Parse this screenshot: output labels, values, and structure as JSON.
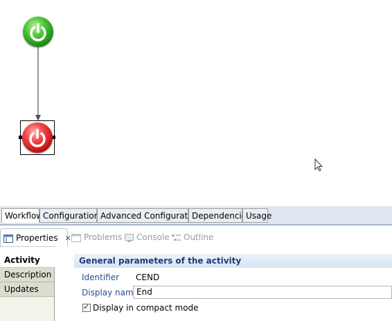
{
  "editor_tabs": [
    "Workflow",
    "Configurations",
    "Advanced Configuration",
    "Dependencies",
    "Usage"
  ],
  "views": {
    "properties": "Properties",
    "problems": "Problems",
    "console": "Console",
    "outline": "Outline"
  },
  "side_tabs": [
    "Activity",
    "Description",
    "Updates"
  ],
  "section": {
    "title": "General parameters of the activity"
  },
  "fields": {
    "identifier_label": "Identifier",
    "identifier_value": "CEND",
    "display_name_label": "Display name",
    "display_name_value": "End",
    "compact_label": "Display in compact mode",
    "compact_checked": "✓"
  },
  "colors": {
    "start_node": "#2fa824",
    "end_node": "#d41e1e",
    "header_text": "#1e3c78"
  }
}
